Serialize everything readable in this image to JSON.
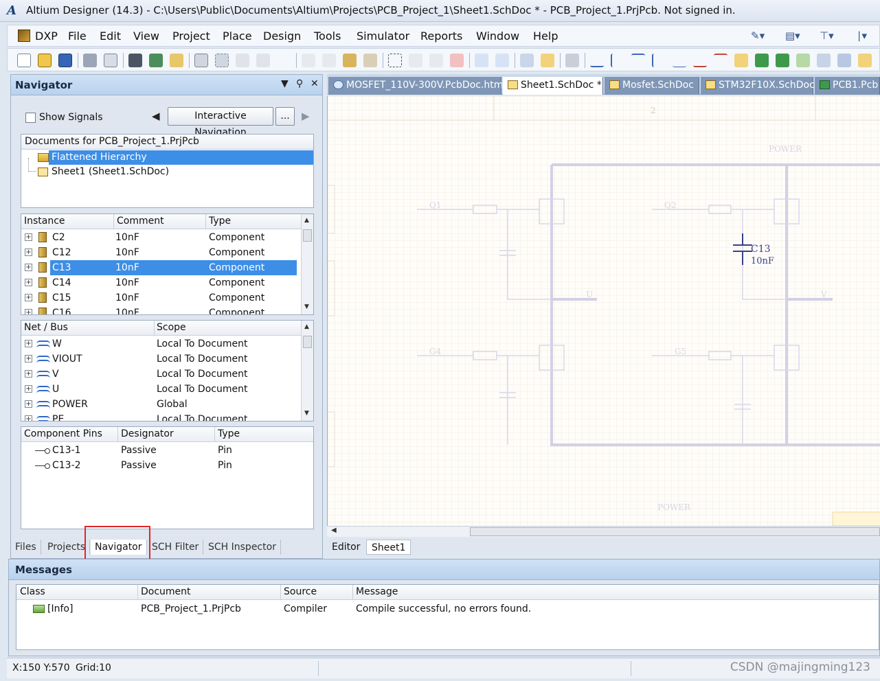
{
  "window": {
    "title": "Altium Designer (14.3) - C:\\Users\\Public\\Documents\\Altium\\Projects\\PCB_Project_1\\Sheet1.SchDoc * - PCB_Project_1.PrjPcb. Not signed in."
  },
  "menu": [
    "DXP",
    "File",
    "Edit",
    "View",
    "Project",
    "Place",
    "Design",
    "Tools",
    "Simulator",
    "Reports",
    "Window",
    "Help"
  ],
  "navigator": {
    "title": "Navigator",
    "show_signals": "Show Signals",
    "interactive_nav": "Interactive Navigation",
    "more": "...",
    "docs_header": "Documents for PCB_Project_1.PrjPcb",
    "docs": [
      "Flattened Hierarchy",
      "Sheet1 (Sheet1.SchDoc)"
    ],
    "instance_cols": [
      "Instance",
      "Comment",
      "Type"
    ],
    "instances": [
      {
        "name": "C2",
        "comment": "10nF",
        "type": "Component"
      },
      {
        "name": "C12",
        "comment": "10nF",
        "type": "Component"
      },
      {
        "name": "C13",
        "comment": "10nF",
        "type": "Component"
      },
      {
        "name": "C14",
        "comment": "10nF",
        "type": "Component"
      },
      {
        "name": "C15",
        "comment": "10nF",
        "type": "Component"
      },
      {
        "name": "C16",
        "comment": "10nF",
        "type": "Component"
      }
    ],
    "net_cols": [
      "Net / Bus",
      "Scope"
    ],
    "nets": [
      {
        "name": "W",
        "scope": "Local To Document"
      },
      {
        "name": "VIOUT",
        "scope": "Local To Document"
      },
      {
        "name": "V",
        "scope": "Local To Document"
      },
      {
        "name": "U",
        "scope": "Local To Document"
      },
      {
        "name": "POWER",
        "scope": "Global"
      },
      {
        "name": "PE",
        "scope": "Local To Document"
      }
    ],
    "pin_cols": [
      "Component Pins",
      "Designator",
      "Type"
    ],
    "pins": [
      {
        "name": "C13-1",
        "designator": "Passive",
        "type": "Pin"
      },
      {
        "name": "C13-2",
        "designator": "Passive",
        "type": "Pin"
      }
    ],
    "tabs": [
      "Files",
      "Projects",
      "Navigator",
      "SCH Filter",
      "SCH Inspector"
    ]
  },
  "doc_tabs": [
    "MOSFET_110V-300V.PcbDoc.htm",
    "Sheet1.SchDoc *",
    "Mosfet.SchDoc",
    "STM32F10X.SchDoc",
    "PCB1.Pcb"
  ],
  "schematic": {
    "labels": {
      "power_top": "POWER",
      "power_bottom": "POWER",
      "q1": "Q1",
      "q2": "Q2",
      "q4": "G4",
      "q5": "G5",
      "u": "U",
      "v": "V",
      "c13": "C13",
      "c13_val": "10nF",
      "ruler2": "2"
    }
  },
  "editor_tabs": [
    "Editor",
    "Sheet1"
  ],
  "messages": {
    "title": "Messages",
    "cols": [
      "Class",
      "Document",
      "Source",
      "Message"
    ],
    "rows": [
      {
        "class": "[Info]",
        "document": "PCB_Project_1.PrjPcb",
        "source": "Compiler",
        "message": "Compile successful, no errors found."
      }
    ]
  },
  "status": {
    "coords": "X:150 Y:570",
    "grid": "Grid:10"
  },
  "watermark": "CSDN @majingming123"
}
